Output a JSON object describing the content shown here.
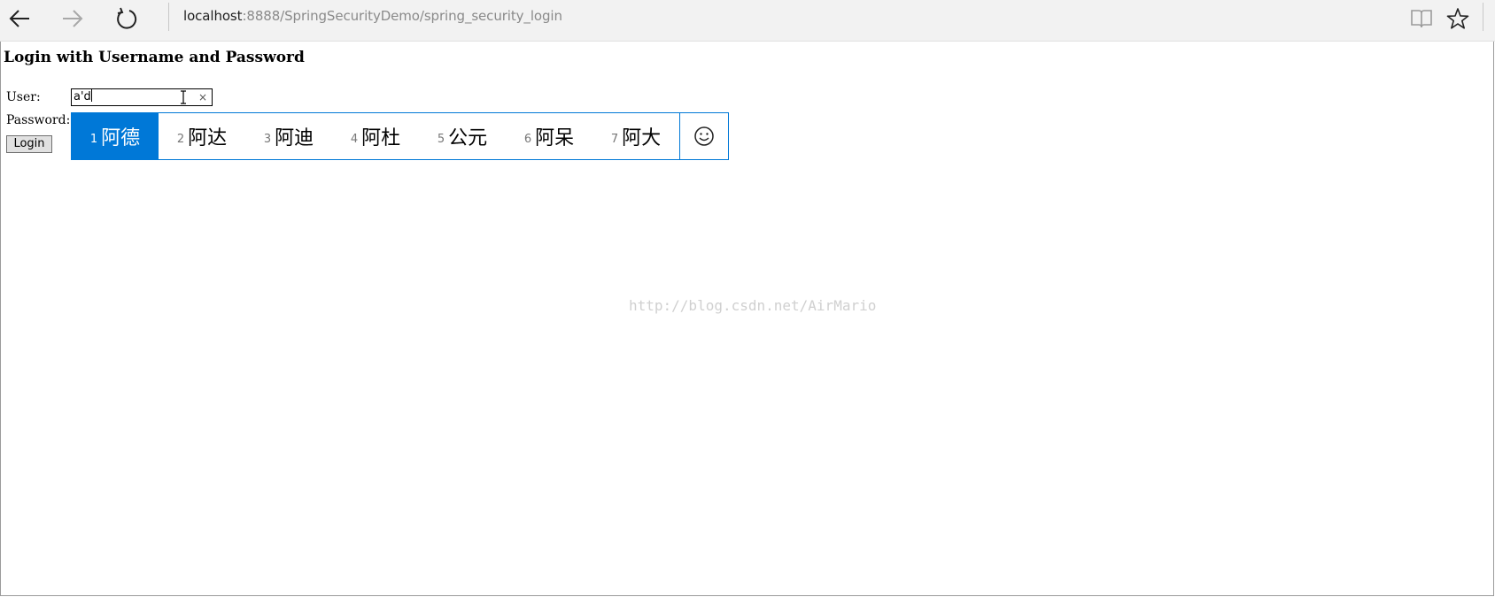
{
  "browser": {
    "address_host": "localhost",
    "address_path": ":8888/SpringSecurityDemo/spring_security_login",
    "icons": [
      "back-icon",
      "forward-icon",
      "reload-icon",
      "reading-view-icon",
      "favorite-star-icon"
    ]
  },
  "page": {
    "title": "Login with Username and Password",
    "user_label": "User:",
    "password_label": "Password:",
    "user_value": "a'd",
    "clear_glyph": "×",
    "login_label": "Login"
  },
  "ime": {
    "candidates": [
      {
        "num": "1",
        "word": "阿德",
        "selected": true
      },
      {
        "num": "2",
        "word": "阿达",
        "selected": false
      },
      {
        "num": "3",
        "word": "阿迪",
        "selected": false
      },
      {
        "num": "4",
        "word": "阿杜",
        "selected": false
      },
      {
        "num": "5",
        "word": "公元",
        "selected": false
      },
      {
        "num": "6",
        "word": "阿呆",
        "selected": false
      },
      {
        "num": "7",
        "word": "阿大",
        "selected": false
      }
    ],
    "accent_color": "#0078d7",
    "emoji_icon": "smiley-icon"
  },
  "watermark": "http://blog.csdn.net/AirMario"
}
